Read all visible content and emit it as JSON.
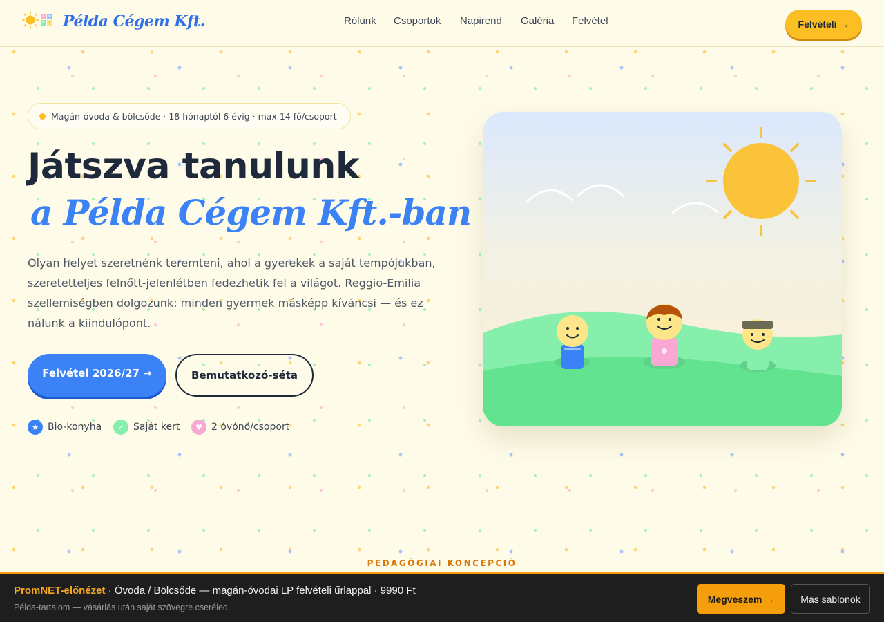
{
  "header": {
    "brand": "Példa Cégem Kft.",
    "logo_blocks": [
      "A",
      "B",
      "C",
      "1"
    ],
    "nav": [
      "Rólunk",
      "Csoportok",
      "Napirend",
      "Galéria",
      "Felvétel"
    ],
    "cta": "Felvételi →"
  },
  "hero": {
    "badge": "Magán-óvoda & bölcsőde · 18 hónaptól 6 évig · max 14 fő/csoport",
    "title_line1": "Játszva tanulunk",
    "title_line2": "a Példa Cégem Kft.-ban",
    "lead": "Olyan helyet szeretnénk teremteni, ahol a gyerekek a saját tempójukban, szeretetteljes felnőtt-jelenlétben fedezhetik fel a világot. Reggio-Emilia szellemiségben dolgozunk: minden gyermek másképp kíváncsi — és ez nálunk a kiindulópont.",
    "primary_button": "Felvétel 2026/27 →",
    "secondary_button": "Bemutatkozó-séta",
    "features": [
      {
        "icon": "star-icon",
        "glyph": "★",
        "color": "#3b82f6",
        "label": "Bio-konyha"
      },
      {
        "icon": "check-icon",
        "glyph": "✓",
        "color": "#86efac",
        "label": "Saját kert"
      },
      {
        "icon": "heart-icon",
        "glyph": "♥",
        "color": "#f9a8d4",
        "label": "2 óvónő/csoport"
      }
    ]
  },
  "section_label": "PEDAGÓGIAI KONCEPCIÓ",
  "bottom_bar": {
    "brand": "PromNET-előnézet",
    "title": " · Óvoda / Bölcsőde — magán-óvodai LP felvételi űrlappal · 9990 Ft",
    "subtitle": "Példa-tartalom — vásárlás után saját szövegre cseréled.",
    "buy_button": "Megveszem →",
    "more_button": "Más sablonok"
  },
  "colors": {
    "accent_blue": "#3b82f6",
    "accent_yellow": "#fbbf24",
    "accent_orange": "#f59e0b",
    "background": "#fefbe9"
  }
}
